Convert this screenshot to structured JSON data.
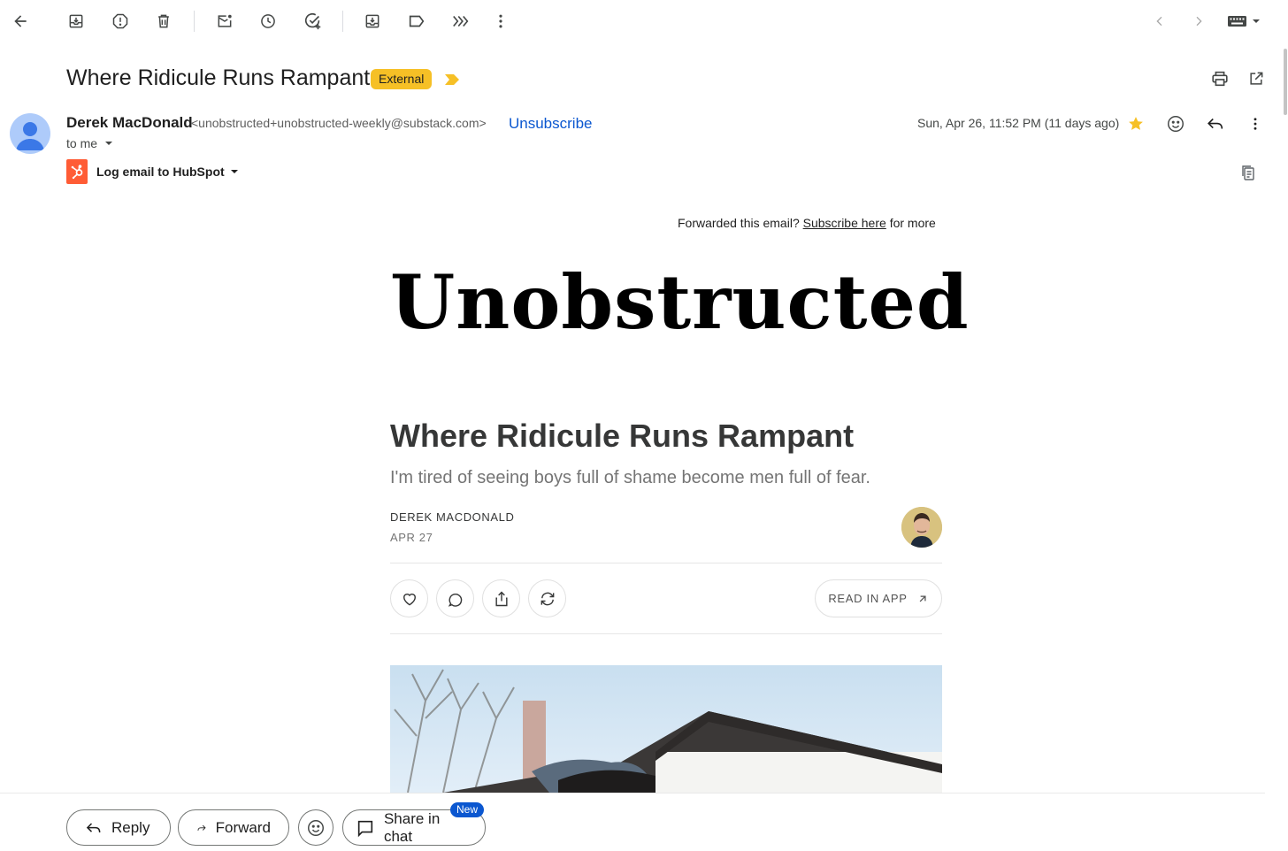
{
  "subject": "Where Ridicule Runs Rampant",
  "label": "External",
  "sender": {
    "name": "Derek MacDonald",
    "email": "<unobstructed+unobstructed-weekly@substack.com>",
    "unsubscribe": "Unsubscribe",
    "recipient": "to me",
    "date": "Sun, Apr 26, 11:52 PM (11 days ago)"
  },
  "hubspot": {
    "label": "Log email to HubSpot"
  },
  "icons": {
    "toolbar": [
      "back-arrow-icon",
      "archive-icon",
      "report-spam-icon",
      "delete-icon",
      "mark-unread-icon",
      "snooze-icon",
      "add-to-tasks-icon",
      "move-to-icon",
      "labels-icon",
      "filter-messages-icon",
      "more-vertical-icon"
    ],
    "nav": [
      "older-chevron-icon",
      "newer-chevron-icon",
      "keyboard-icon"
    ],
    "header": [
      "print-icon",
      "open-new-window-icon",
      "star-icon",
      "emoji-reaction-icon",
      "reply-icon",
      "more-vertical-icon"
    ]
  },
  "colors": {
    "star": "#f6c026",
    "link": "#0b57d0",
    "badge": "#f6c026",
    "hubspot": "#ff5c35"
  },
  "newsletter": {
    "forward_prefix": "Forwarded this email?",
    "forward_link": "Subscribe here",
    "forward_suffix": "for more",
    "masthead": "Unobstructed",
    "title": "Where Ridicule Runs Rampant",
    "subtitle": "I'm tired of seeing boys full of shame become men full of fear.",
    "author": "DEREK MACDONALD",
    "date": "APR 27",
    "read_in_app": "READ IN APP"
  },
  "actions": {
    "reply": "Reply",
    "forward": "Forward",
    "share_in_chat": "Share in chat",
    "new_badge": "New"
  }
}
